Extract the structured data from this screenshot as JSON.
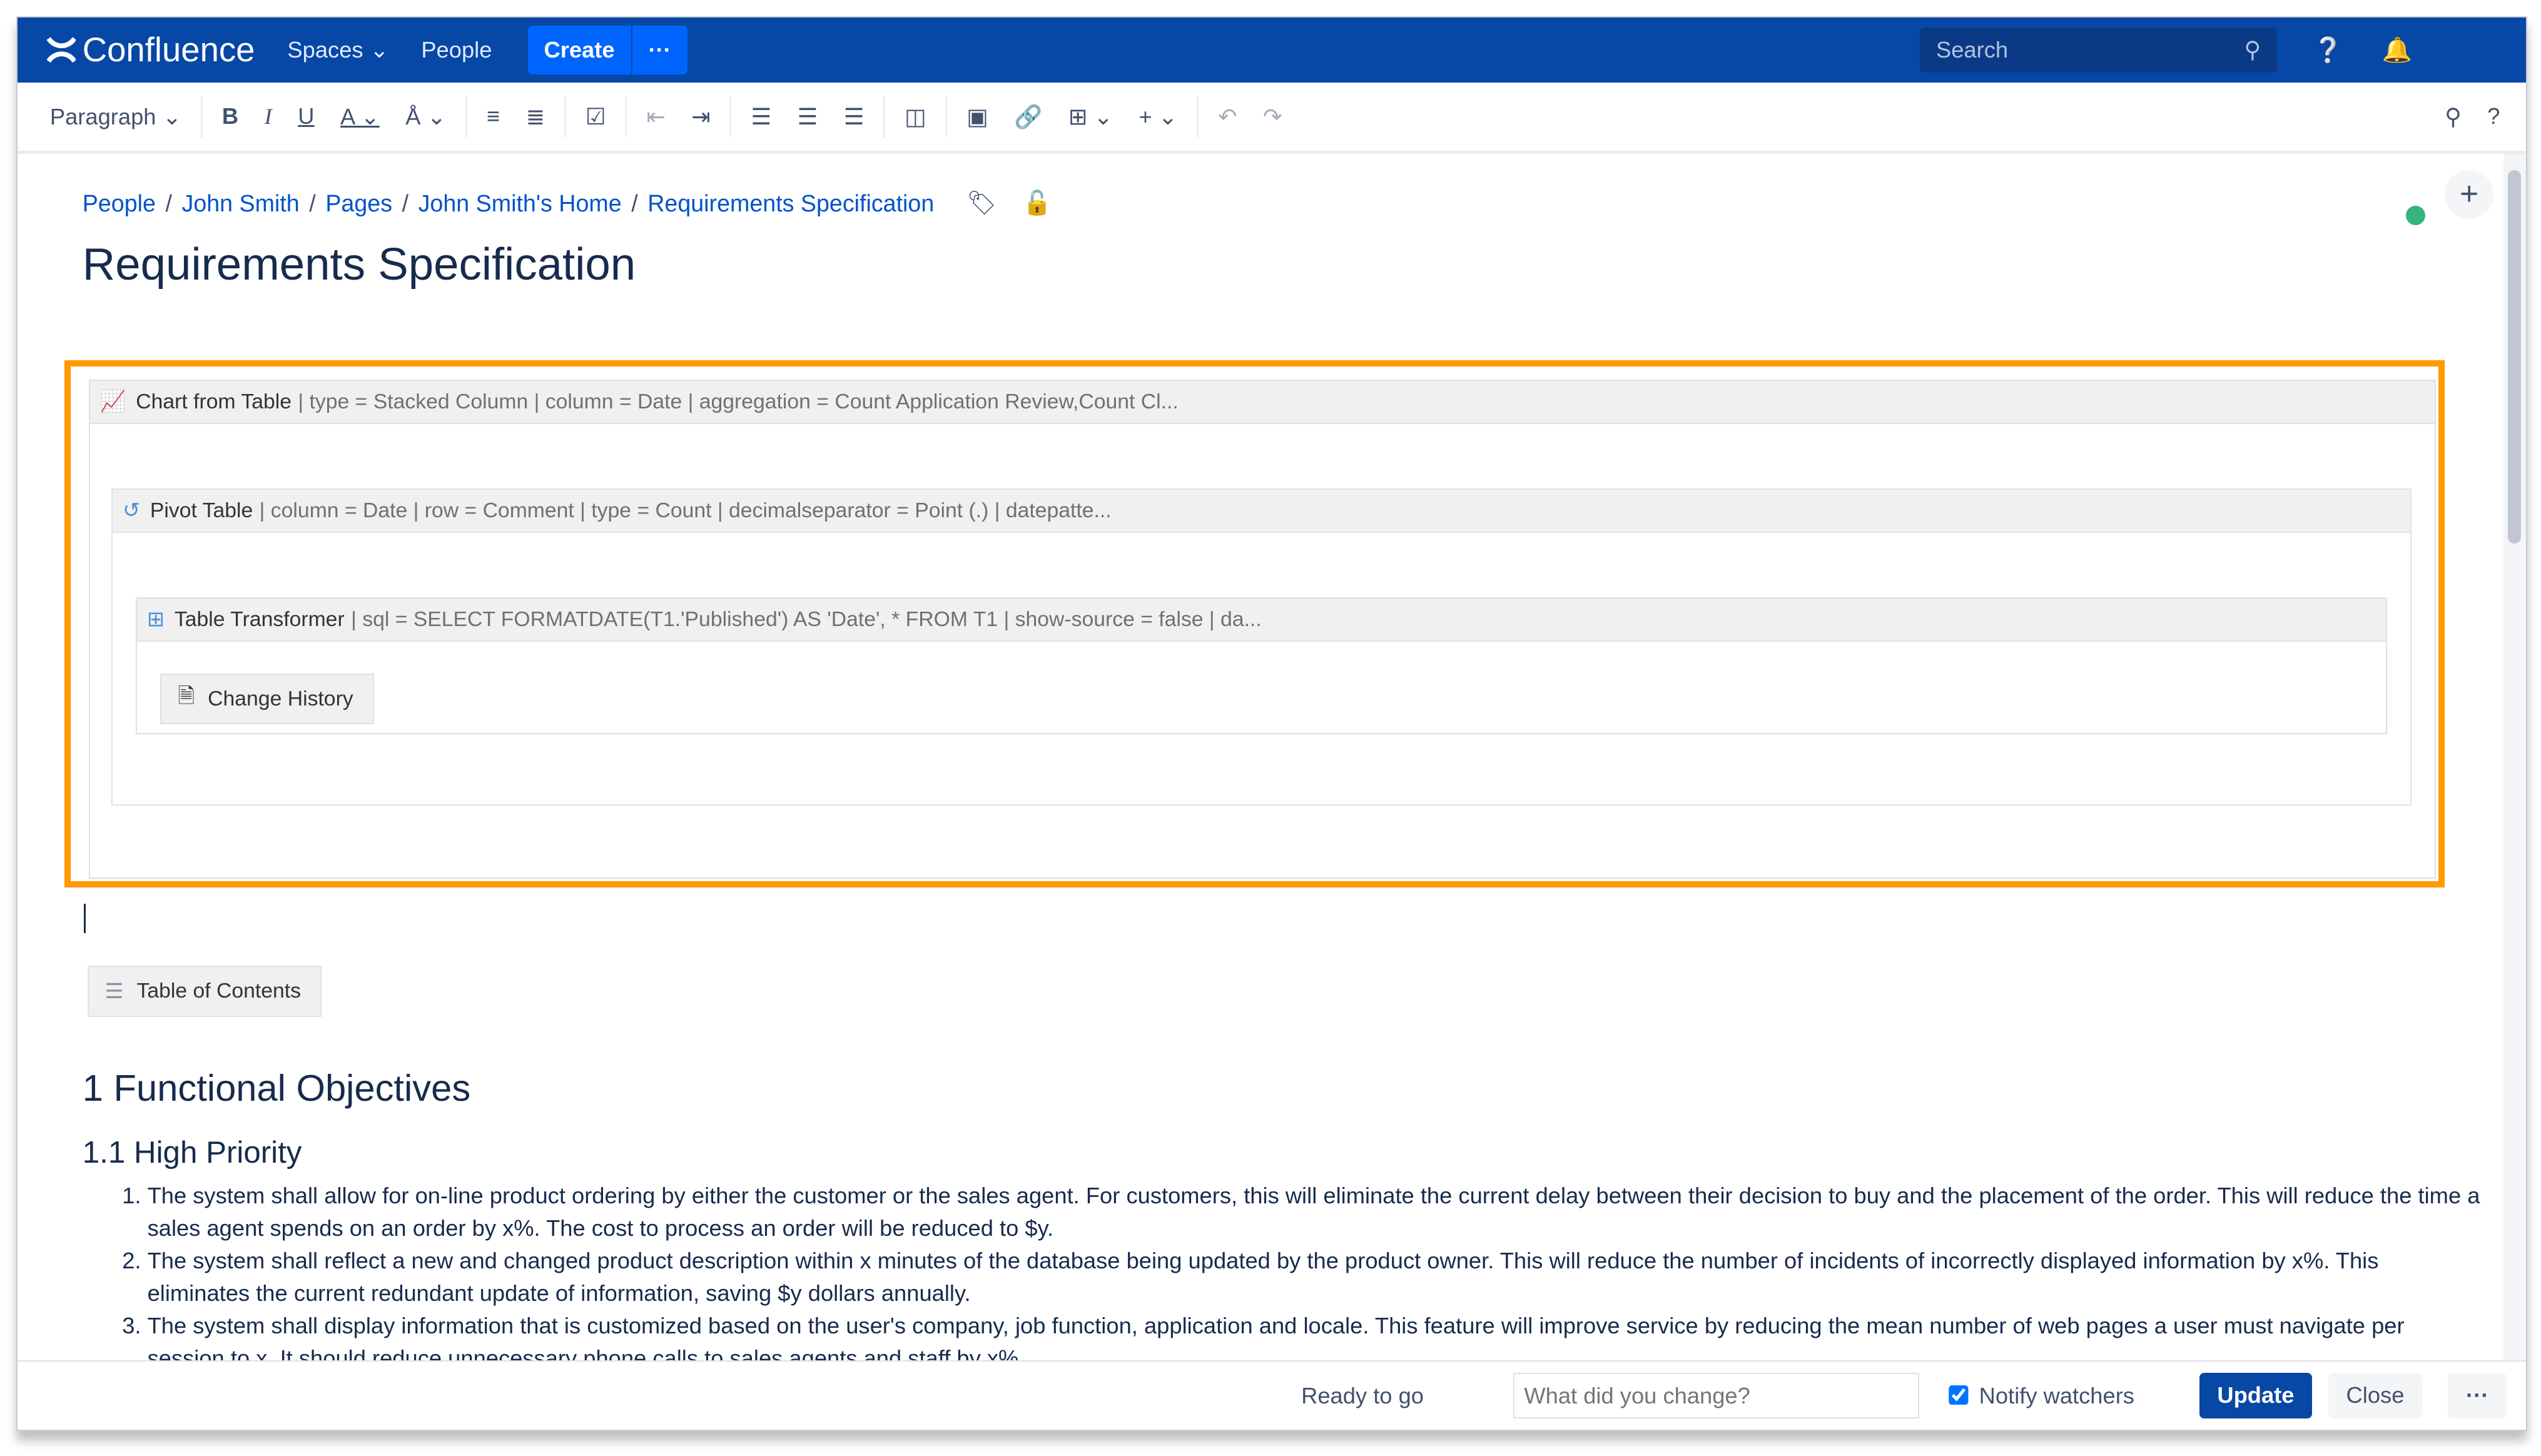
{
  "header": {
    "app_name": "Confluence",
    "nav": [
      {
        "label": "Spaces"
      },
      {
        "label": "People"
      }
    ],
    "create_label": "Create",
    "more_label": "···",
    "search_placeholder": "Search"
  },
  "toolbar": {
    "paragraph_style": "Paragraph"
  },
  "breadcrumb": [
    "People",
    "John Smith",
    "Pages",
    "John Smith's Home",
    "Requirements Specification"
  ],
  "page_title": "Requirements Specification",
  "macros": {
    "chart": {
      "name": "Chart from Table",
      "params": "| type = Stacked Column | column = Date | aggregation = Count Application Review,Count Cl..."
    },
    "pivot": {
      "name": "Pivot Table",
      "params": "| column = Date | row = Comment | type = Count | decimalseparator = Point (.) | datepatte..."
    },
    "transformer": {
      "name": "Table Transformer",
      "params": "| sql = SELECT FORMATDATE(T1.'Published') AS 'Date', * FROM T1 | show-source = false | da..."
    },
    "change_history": "Change History",
    "toc": "Table of Contents"
  },
  "highlight_color": "#ff9900",
  "sections": {
    "h1": "1 Functional Objectives",
    "h2": "1.1 High Priority"
  },
  "list_items": [
    "The system shall allow for on-line product ordering by either the customer or the sales agent. For customers, this will eliminate the current delay between their decision to buy and the placement of the order. This will reduce the time a sales agent spends on an order by x%. The cost to process an order will be reduced to $y.",
    "The system shall reflect a new and changed product description within x minutes of the database being updated by the product owner. This will reduce the number of incidents of incorrectly displayed information by x%. This eliminates the current redundant update of information, saving $y dollars annually.",
    "The system shall display information that is customized based on the user's company, job function, application and locale. This feature will improve service by reducing the mean number of web pages a user must navigate per session to x. It should reduce unnecessary phone calls to sales agents and staff by x%."
  ],
  "footer": {
    "status": "Ready to go",
    "change_placeholder": "What did you change?",
    "notify_label": "Notify watchers",
    "notify_checked": true,
    "update_label": "Update",
    "close_label": "Close",
    "more_label": "···"
  }
}
